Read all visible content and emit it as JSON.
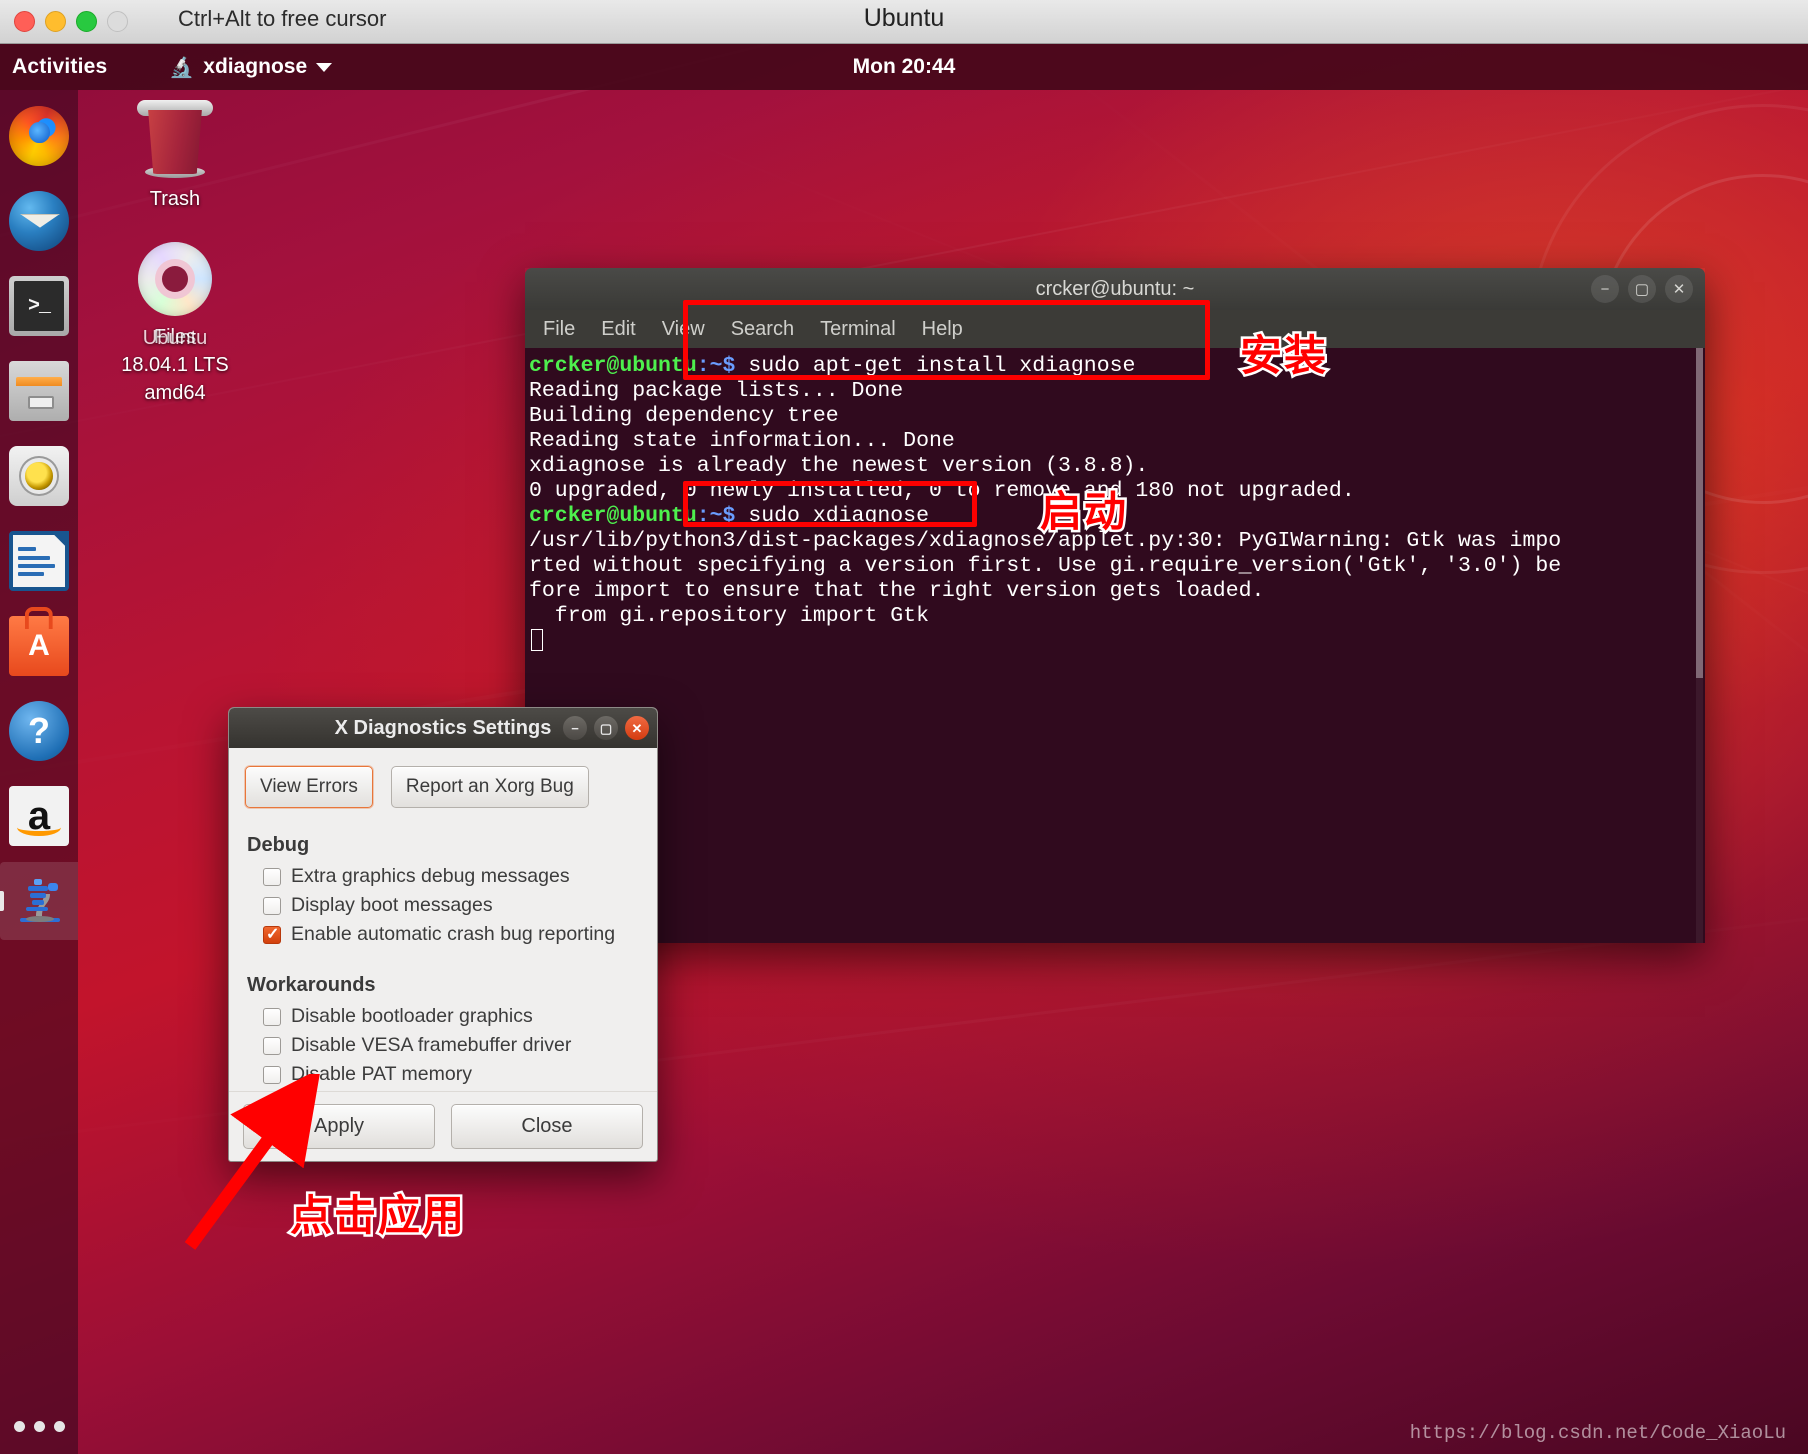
{
  "vm": {
    "hint": "Ctrl+Alt to free cursor",
    "title": "Ubuntu"
  },
  "topbar": {
    "activities": "Activities",
    "app_name": "xdiagnose",
    "app_icon": "microscope-icon",
    "clock": "Mon 20:44"
  },
  "launcher": {
    "items": [
      {
        "name": "firefox",
        "label": "Firefox",
        "active": false
      },
      {
        "name": "thunderbird",
        "label": "Thunderbird Mail",
        "active": false
      },
      {
        "name": "terminal",
        "label": "Terminal",
        "prompt": ">_",
        "active": false
      },
      {
        "name": "files",
        "label": "Files",
        "active": false
      },
      {
        "name": "rhythmbox",
        "label": "Rhythmbox",
        "active": false
      },
      {
        "name": "libreoffice-writer",
        "label": "LibreOffice Writer",
        "active": false
      },
      {
        "name": "ubuntu-software",
        "label": "Ubuntu Software",
        "glyph": "A",
        "active": false
      },
      {
        "name": "help",
        "label": "Help",
        "glyph": "?",
        "active": false
      },
      {
        "name": "amazon",
        "label": "Amazon",
        "glyph": "a",
        "active": false
      },
      {
        "name": "xdiagnose",
        "label": "xdiagnose",
        "active": true
      }
    ]
  },
  "desktop_icons": [
    {
      "name": "trash",
      "label": "Trash"
    },
    {
      "name": "ubuntu-iso-disc",
      "label_lines": [
        "Files",
        "Ubuntu",
        "18.04.1 LTS",
        "amd64"
      ],
      "overlap_a": "Files",
      "overlap_b": "Ubuntu",
      "overlap_c": "18.04.1 LTS",
      "overlap_d": "amd64"
    }
  ],
  "terminal": {
    "title": "crcker@ubuntu: ~",
    "menus": [
      "File",
      "Edit",
      "View",
      "Search",
      "Terminal",
      "Help"
    ],
    "window_buttons": [
      "minimize",
      "maximize",
      "close"
    ],
    "lines": [
      {
        "prompt": "crcker@ubuntu",
        "sep": ":~$ ",
        "cmd": "sudo apt-get install xdiagnose",
        "type": "prompt"
      },
      {
        "text": "Reading package lists... Done",
        "type": "out"
      },
      {
        "text": "Building dependency tree",
        "type": "out"
      },
      {
        "text": "Reading state information... Done",
        "type": "out"
      },
      {
        "text": "xdiagnose is already the newest version (3.8.8).",
        "type": "out"
      },
      {
        "text": "0 upgraded, 0 newly installed, 0 to remove and 180 not upgraded.",
        "type": "out"
      },
      {
        "prompt": "crcker@ubuntu",
        "sep": ":~$ ",
        "cmd": "sudo xdiagnose",
        "type": "prompt"
      },
      {
        "text": "/usr/lib/python3/dist-packages/xdiagnose/applet.py:30: PyGIWarning: Gtk was impo",
        "type": "out"
      },
      {
        "text": "rted without specifying a version first. Use gi.require_version('Gtk', '3.0') be",
        "type": "out"
      },
      {
        "text": "fore import to ensure that the right version gets loaded.",
        "type": "out"
      },
      {
        "text": "  from gi.repository import Gtk",
        "type": "out"
      }
    ]
  },
  "dialog": {
    "title": "X Diagnostics Settings",
    "window_buttons": [
      "minimize",
      "maximize",
      "close"
    ],
    "top_buttons": [
      {
        "label": "View Errors",
        "focused": true
      },
      {
        "label": "Report an Xorg Bug",
        "focused": false
      }
    ],
    "sections": [
      {
        "heading": "Debug",
        "options": [
          {
            "label": "Extra graphics debug messages",
            "checked": false
          },
          {
            "label": "Display boot messages",
            "checked": false
          },
          {
            "label": "Enable automatic crash bug reporting",
            "checked": true
          }
        ]
      },
      {
        "heading": "Workarounds",
        "options": [
          {
            "label": "Disable bootloader graphics",
            "checked": false
          },
          {
            "label": "Disable VESA framebuffer driver",
            "checked": false
          },
          {
            "label": "Disable PAT memory",
            "checked": false
          }
        ]
      }
    ],
    "footer": [
      {
        "label": "Apply"
      },
      {
        "label": "Close"
      }
    ]
  },
  "annotations": {
    "install_note": "安装",
    "launch_note": "启动",
    "apply_note": "点击应用",
    "accent_red": "#fd0000"
  },
  "watermark": "https://blog.csdn.net/Code_XiaoLu"
}
